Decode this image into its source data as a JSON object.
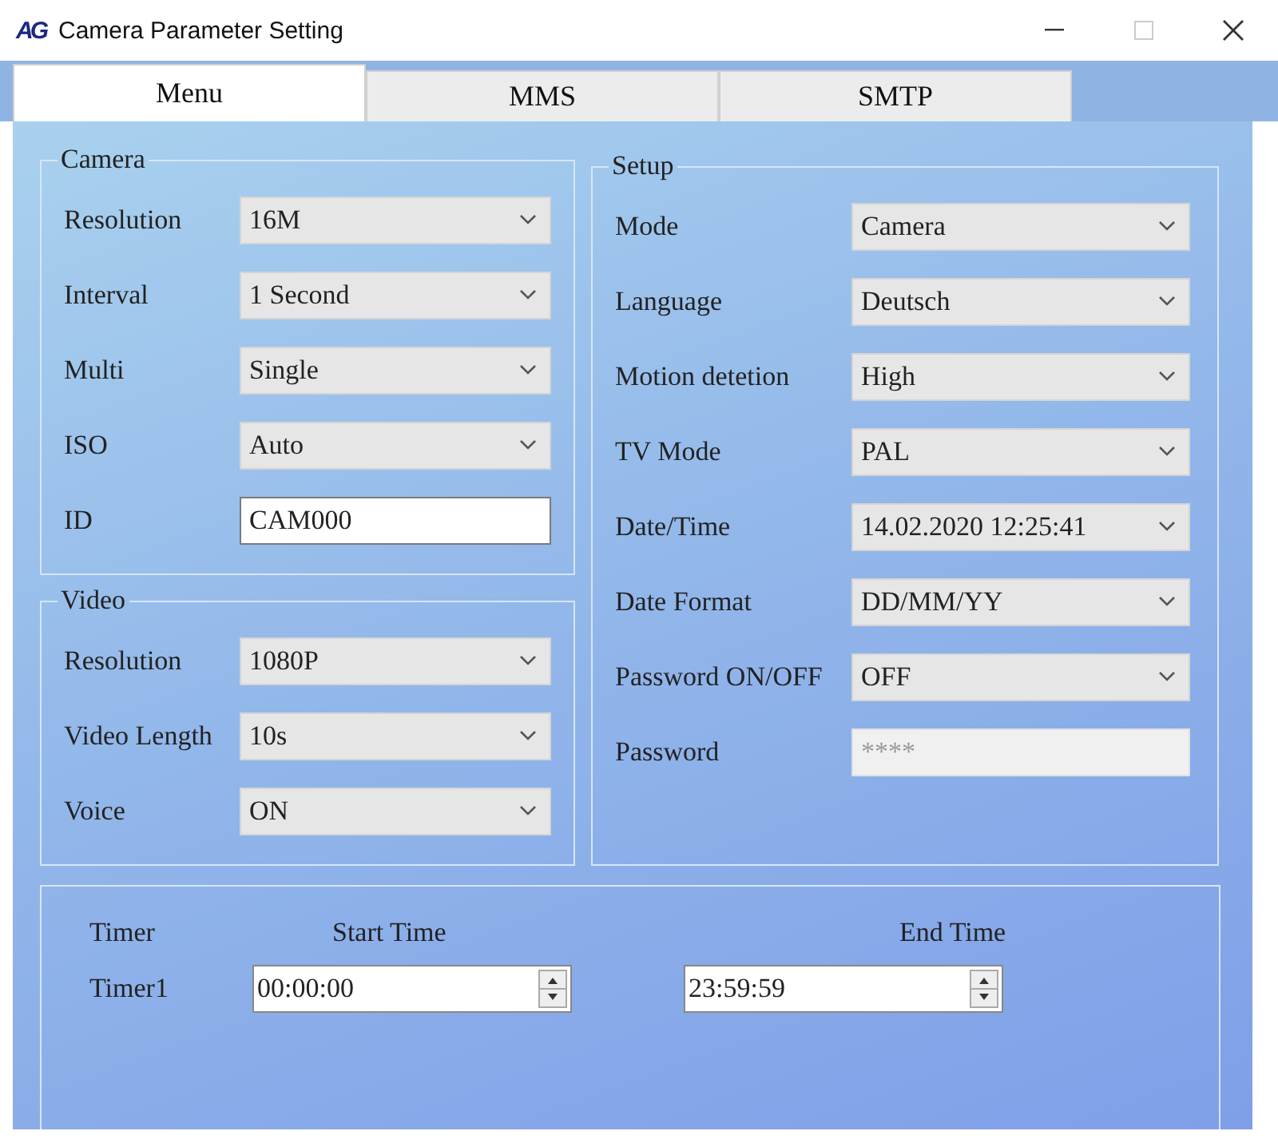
{
  "window": {
    "logo": "AG",
    "title": "Camera Parameter Setting",
    "maximize_disabled": true
  },
  "tabs": [
    {
      "label": "Menu",
      "selected": true
    },
    {
      "label": "MMS",
      "selected": false
    },
    {
      "label": "SMTP",
      "selected": false
    }
  ],
  "camera": {
    "title": "Camera",
    "fields": [
      {
        "label": "Resolution",
        "kind": "select",
        "value": "16M"
      },
      {
        "label": "Interval",
        "kind": "select",
        "value": "1 Second"
      },
      {
        "label": "Multi",
        "kind": "select",
        "value": "Single"
      },
      {
        "label": "ISO",
        "kind": "select",
        "value": "Auto"
      },
      {
        "label": "ID",
        "kind": "text",
        "value": "CAM000"
      }
    ]
  },
  "video": {
    "title": "Video",
    "fields": [
      {
        "label": "Resolution",
        "kind": "select",
        "value": "1080P"
      },
      {
        "label": "Video Length",
        "kind": "select",
        "value": "10s"
      },
      {
        "label": "Voice",
        "kind": "select",
        "value": "ON"
      }
    ]
  },
  "setup": {
    "title": "Setup",
    "fields": [
      {
        "label": "Mode",
        "kind": "select",
        "value": "Camera"
      },
      {
        "label": "Language",
        "kind": "select",
        "value": "Deutsch"
      },
      {
        "label": "Motion detetion",
        "kind": "select",
        "value": "High"
      },
      {
        "label": "TV Mode",
        "kind": "select",
        "value": "PAL"
      },
      {
        "label": "Date/Time",
        "kind": "select",
        "value": "14.02.2020 12:25:41"
      },
      {
        "label": "Date Format",
        "kind": "select",
        "value": "DD/MM/YY"
      },
      {
        "label": "Password ON/OFF",
        "kind": "select",
        "value": "OFF"
      },
      {
        "label": "Password",
        "kind": "password",
        "value": "****",
        "disabled": true
      }
    ]
  },
  "timer": {
    "header": "Timer",
    "start_heading": "Start Time",
    "end_heading": "End Time",
    "rows": [
      {
        "name": "Timer1",
        "start": "00:00:00",
        "end": "23:59:59"
      }
    ]
  }
}
